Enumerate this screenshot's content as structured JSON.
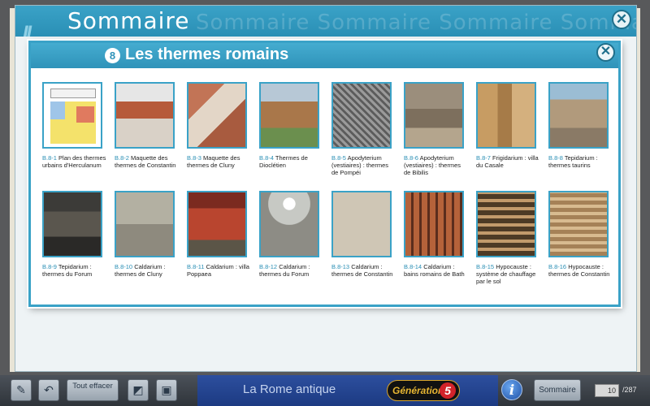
{
  "outer": {
    "title": "Sommaire",
    "ghost_title": "Sommaire Sommaire Sommaire Sommaire",
    "close_label": "✕"
  },
  "modal": {
    "number": "8",
    "title": "Les thermes romains",
    "close_label": "✕"
  },
  "items": [
    {
      "code": "B.8-1",
      "text": " Plan des thermes urbains d'Herculanum",
      "thumb": "floor-plan"
    },
    {
      "code": "B.8-2",
      "text": " Maquette des thermes de Constantin",
      "thumb": "model"
    },
    {
      "code": "B.8-3",
      "text": " Maquette des thermes de Cluny",
      "thumb": "model"
    },
    {
      "code": "B.8-4",
      "text": " Thermes de Dioclétien",
      "thumb": "building"
    },
    {
      "code": "B.8-5",
      "text": " Apodyterium (vestiaires) : thermes de Pompéi",
      "thumb": "vault"
    },
    {
      "code": "B.8-6",
      "text": " Apodyterium (vestiaires) : thermes de Bibilis",
      "thumb": "ruins"
    },
    {
      "code": "B.8-7",
      "text": " Frigidarium : villa du Casale",
      "thumb": "columns"
    },
    {
      "code": "B.8-8",
      "text": " Tepidarium : thermes taurins",
      "thumb": "ruins"
    },
    {
      "code": "B.8-9",
      "text": " Tepidarium : thermes du Forum",
      "thumb": "interior"
    },
    {
      "code": "B.8-10",
      "text": " Caldarium : thermes de Cluny",
      "thumb": "wall"
    },
    {
      "code": "B.8-11",
      "text": " Caldarium : villa Poppaea",
      "thumb": "fresco"
    },
    {
      "code": "B.8-12",
      "text": " Caldarium : thermes du Forum",
      "thumb": "dome"
    },
    {
      "code": "B.8-13",
      "text": " Caldarium : thermes de Constantin",
      "thumb": "wall"
    },
    {
      "code": "B.8-14",
      "text": " Caldarium : bains romains de Bath",
      "thumb": "hypocaust"
    },
    {
      "code": "B.8-15",
      "text": " Hypocauste : système de chauffage par le sol",
      "thumb": "hypocaust"
    },
    {
      "code": "B.8-16",
      "text": " Hypocauste : thermes de Constantin",
      "thumb": "hypocaust"
    }
  ],
  "toolbar": {
    "pen_icon": "pen-icon",
    "undo_icon": "undo-arrow-icon",
    "effacer_label": "Tout effacer",
    "layout_icon": "layout-icon",
    "box_icon": "box-icon",
    "subject": "La Rome antique",
    "brand": "Génération",
    "brand_number": "5",
    "info_label": "i",
    "sommaire_label": "Sommaire",
    "current_page": "10",
    "total_pages": "/287"
  },
  "colors": {
    "accent": "#3aa2c7",
    "code": "#2a8fb5",
    "toolbar": "#3a3f45",
    "subject_bar": "#1c3a82"
  }
}
